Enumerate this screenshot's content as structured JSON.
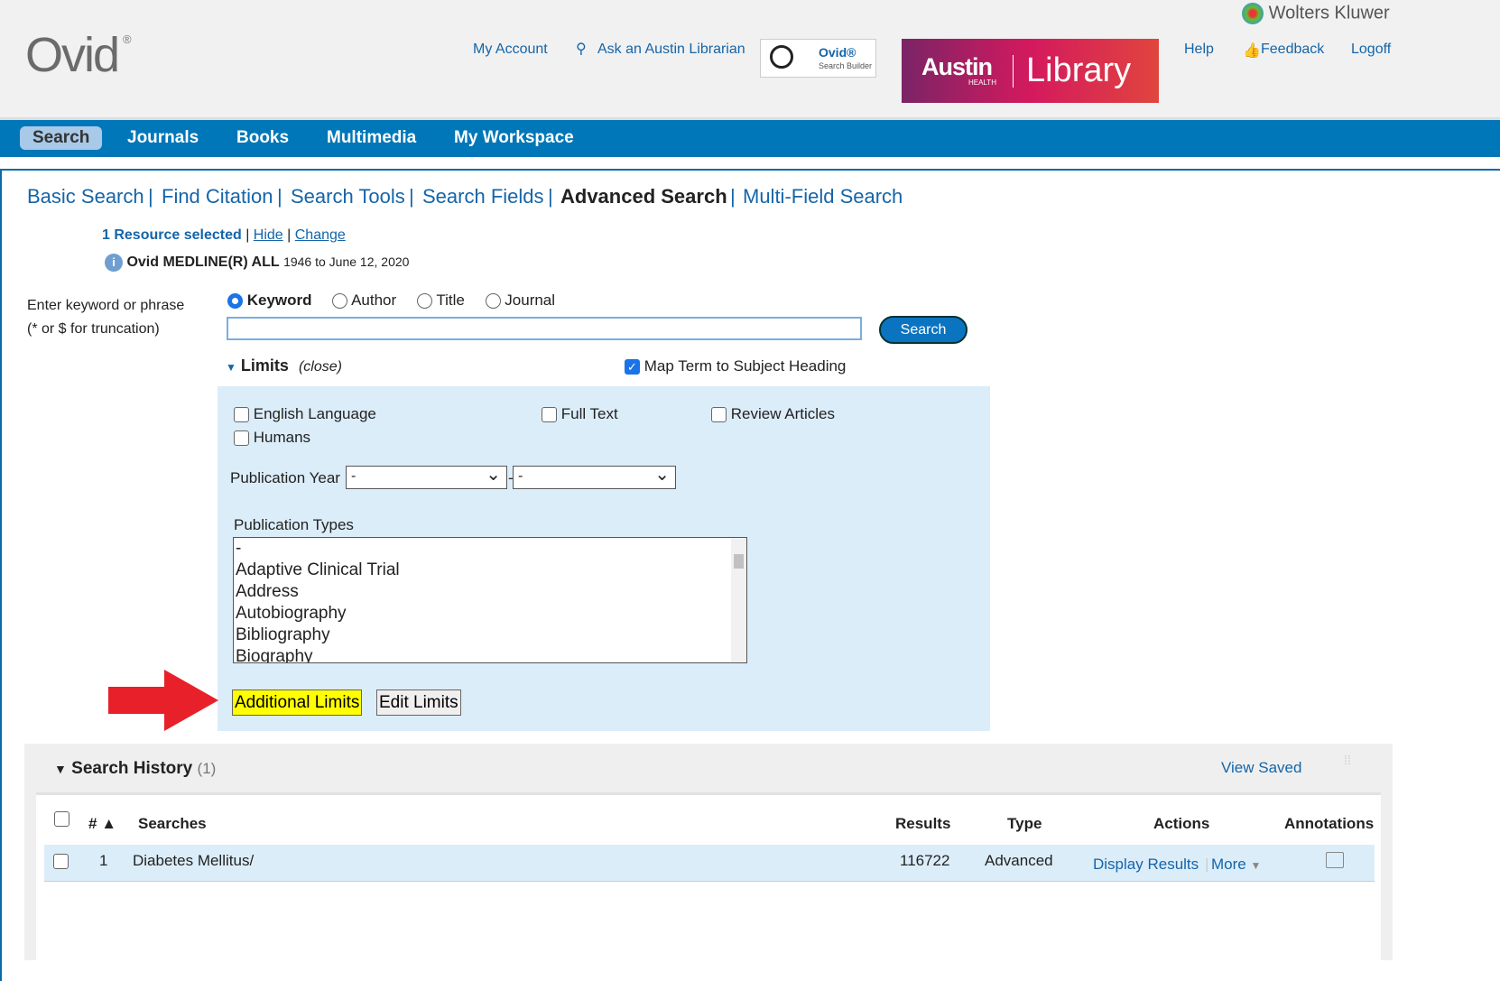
{
  "header": {
    "logo": "Ovid",
    "brand": "Wolters Kluwer",
    "my_account": "My Account",
    "ask_librarian": "Ask an Austin Librarian",
    "search_builder_logo": "Ovid Search Builder",
    "library_banner": "Austin HEALTH | Library",
    "help": "Help",
    "feedback": "Feedback",
    "logoff": "Logoff"
  },
  "nav": [
    "Search",
    "Journals",
    "Books",
    "Multimedia",
    "My Workspace"
  ],
  "tabs": [
    "Basic Search",
    "Find Citation",
    "Search Tools",
    "Search Fields",
    "Advanced Search",
    "Multi-Field Search"
  ],
  "resource": {
    "selected": "1 Resource selected",
    "hide": "Hide",
    "change": "Change",
    "db": "Ovid MEDLINE(R) ALL",
    "range": "1946 to June 12, 2020"
  },
  "search": {
    "prompt1": "Enter keyword or phrase",
    "prompt2": "(* or $ for truncation)",
    "options": [
      "Keyword",
      "Author",
      "Title",
      "Journal"
    ],
    "selected": "Keyword",
    "value": "",
    "button": "Search"
  },
  "limits": {
    "title": "Limits",
    "close": "(close)",
    "map_term": "Map Term to Subject Heading",
    "map_term_checked": true,
    "checkboxes": [
      "English Language",
      "Full Text",
      "Review Articles",
      "Humans"
    ],
    "pub_year_label": "Publication Year",
    "pub_year_from": "-",
    "pub_year_to": "-",
    "pub_year_sep": "-",
    "pub_types_label": "Publication Types",
    "pub_types": [
      "-",
      "Adaptive Clinical Trial",
      "Address",
      "Autobiography",
      "Bibliography",
      "Biography"
    ],
    "additional": "Additional Limits",
    "edit": "Edit Limits"
  },
  "history": {
    "title": "Search History",
    "count": "(1)",
    "view_saved": "View Saved",
    "columns": [
      "#",
      "Searches",
      "Results",
      "Type",
      "Actions",
      "Annotations"
    ],
    "rows": [
      {
        "num": "1",
        "search": "Diabetes Mellitus/",
        "results": "116722",
        "type": "Advanced",
        "display": "Display Results",
        "more": "More"
      }
    ]
  },
  "colors": {
    "nav": "#0077b8",
    "limits_bg": "#dcedfa",
    "highlight": "#ffff00",
    "arrow": "#e8202a"
  }
}
